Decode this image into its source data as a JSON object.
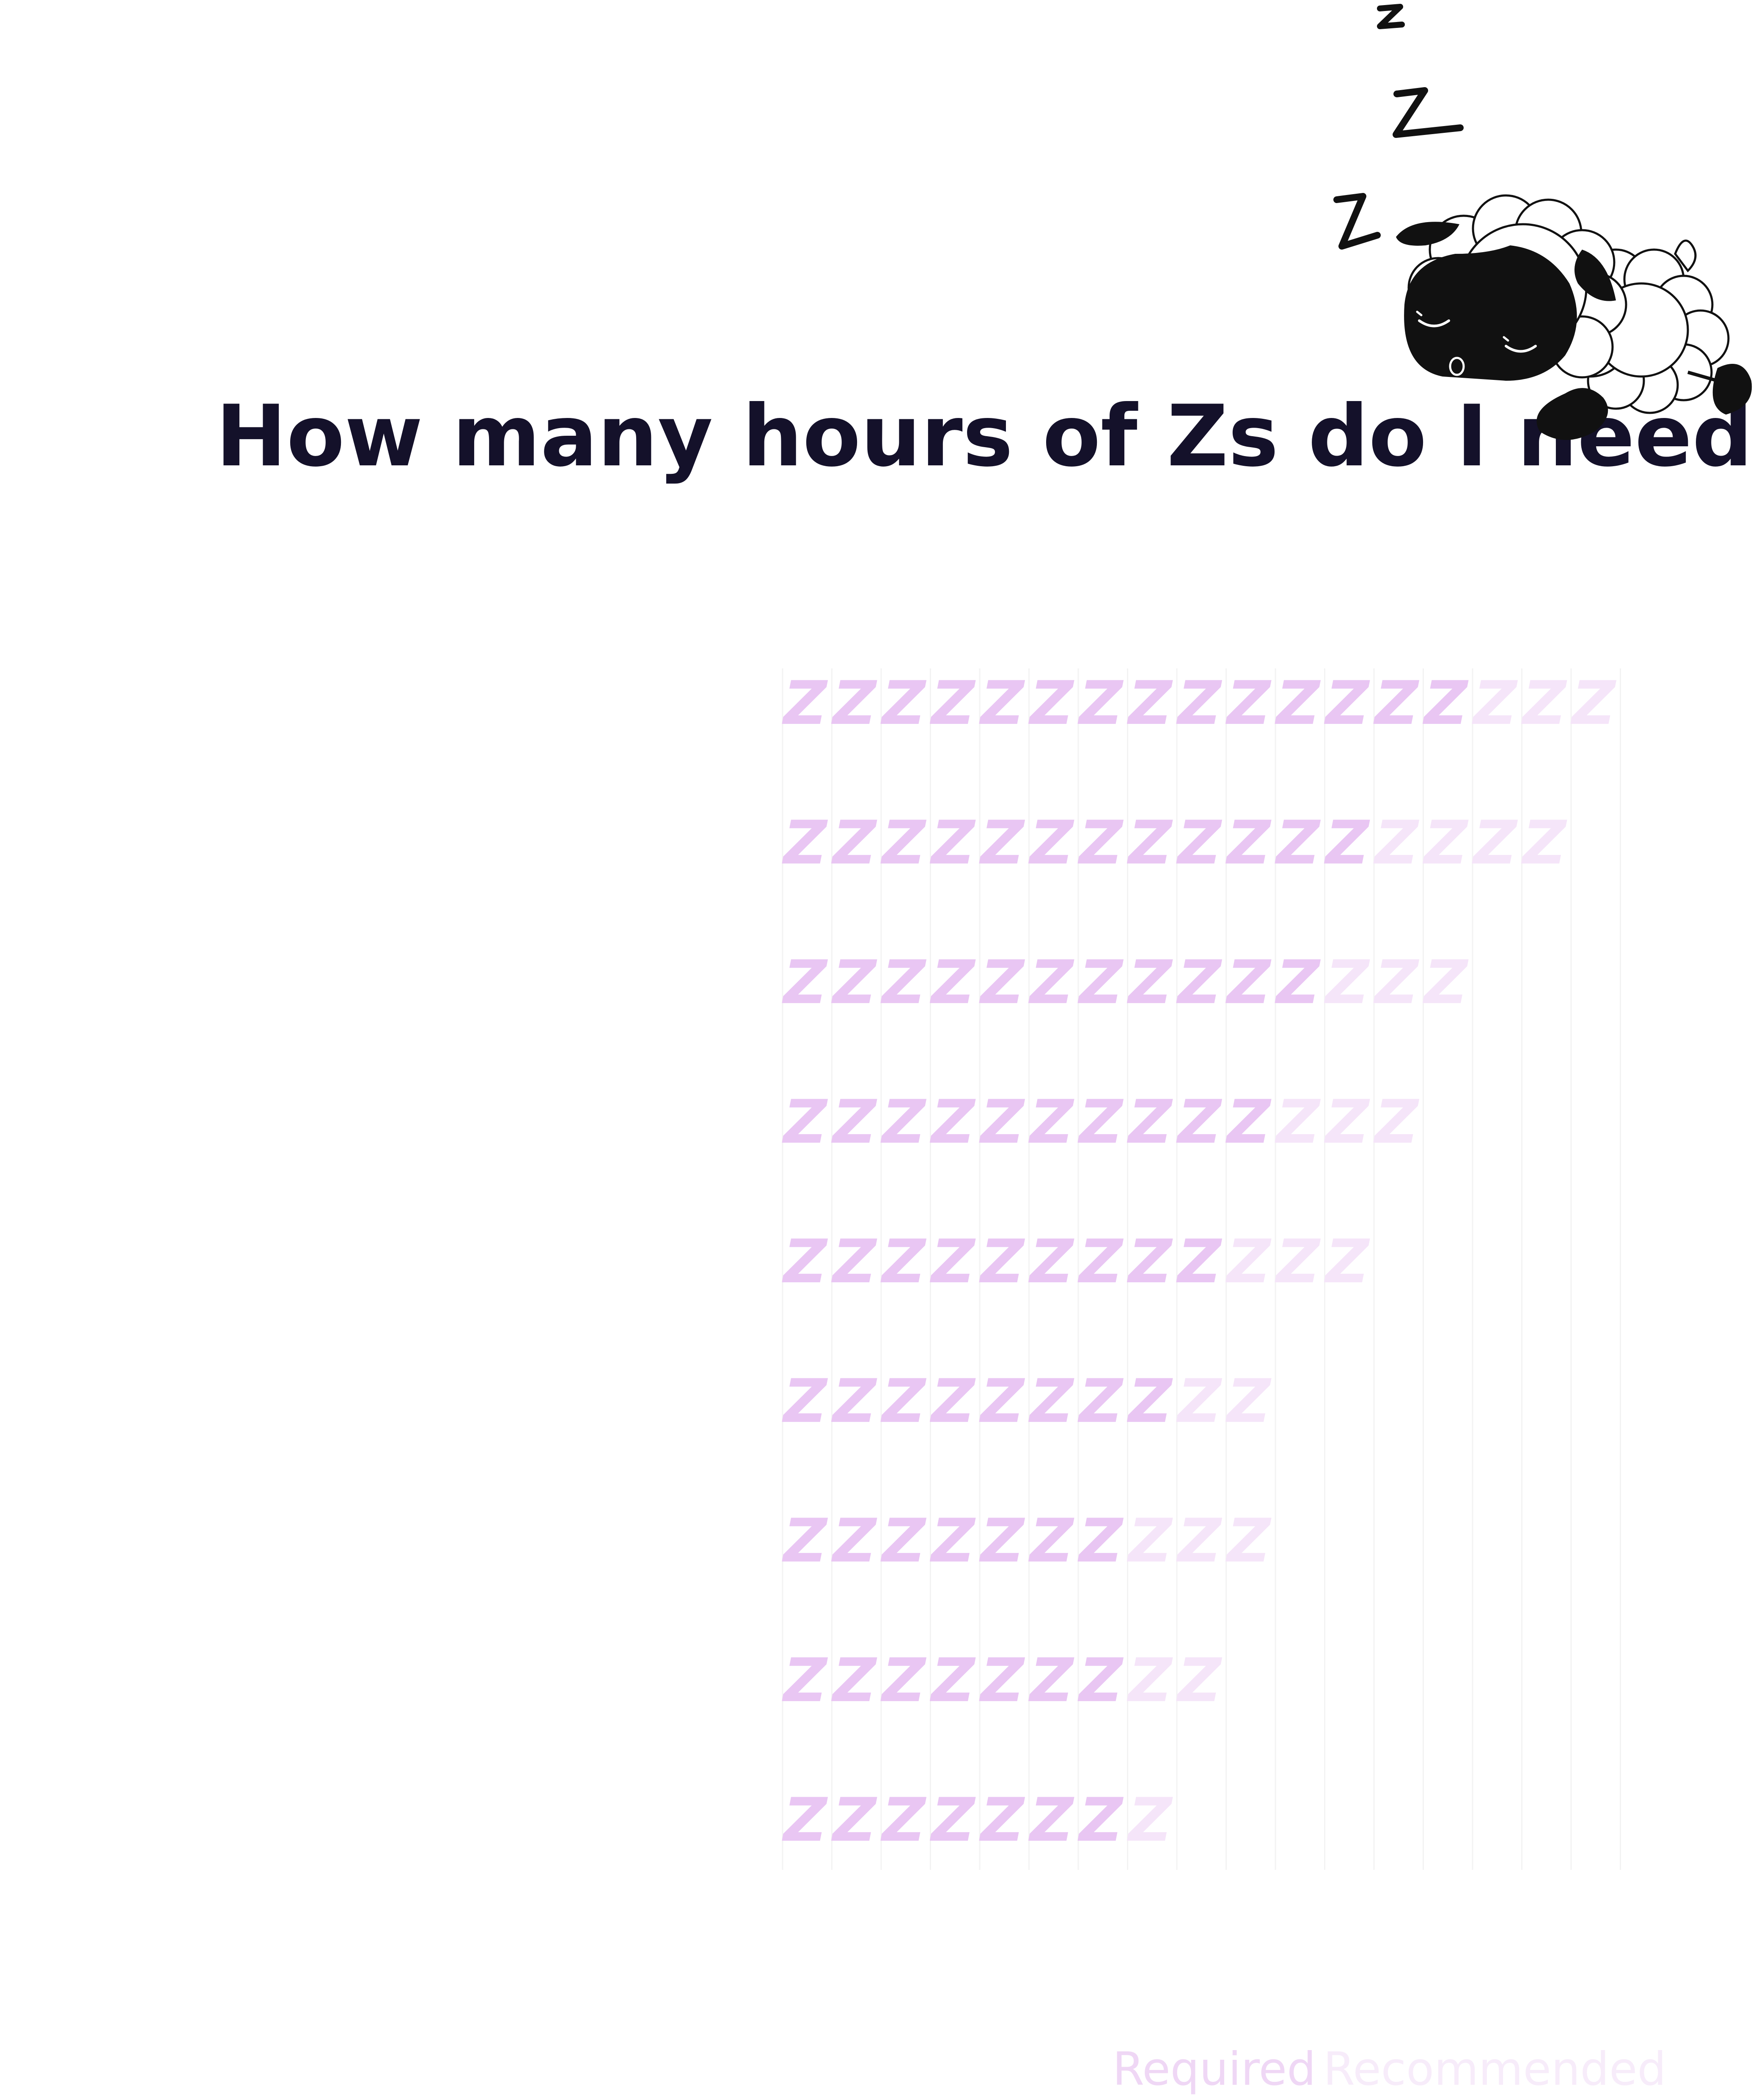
{
  "chart_data": {
    "type": "bar",
    "title": "How many hours of Zs do I need?",
    "xlabel": "",
    "ylabel": "",
    "xlim": [
      0,
      17
    ],
    "categories": [
      "",
      "",
      "",
      "",
      "",
      "",
      "",
      "",
      ""
    ],
    "series": [
      {
        "name": "Required",
        "values": [
          14,
          12,
          11,
          10,
          9,
          8,
          7,
          7,
          7
        ]
      },
      {
        "name": "Recommended",
        "values": [
          3,
          4,
          3,
          3,
          3,
          2,
          3,
          2,
          1
        ]
      }
    ],
    "mark": "Z",
    "grid": true,
    "legend": "bottom-right",
    "colors": {
      "required": "#e9c6f3",
      "recommended": "#f5e5f9",
      "title": "#14112a",
      "grid": "#f3f3f3",
      "legend_required": "#efd7f5",
      "legend_recommended": "#f7ecfa"
    }
  },
  "illustration": {
    "icon": "sleeping-sheep-icon",
    "z_icon": "z-icon"
  }
}
